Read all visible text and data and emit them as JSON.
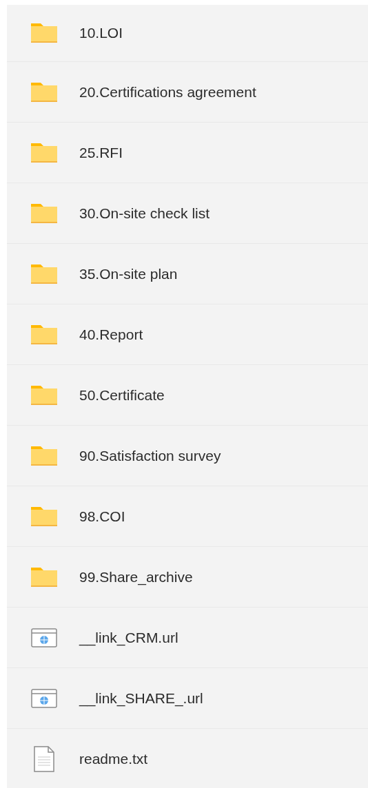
{
  "items": [
    {
      "kind": "folder",
      "name": "10.LOI"
    },
    {
      "kind": "folder",
      "name": "20.Certifications agreement"
    },
    {
      "kind": "folder",
      "name": "25.RFI"
    },
    {
      "kind": "folder",
      "name": "30.On-site check list"
    },
    {
      "kind": "folder",
      "name": "35.On-site plan"
    },
    {
      "kind": "folder",
      "name": "40.Report"
    },
    {
      "kind": "folder",
      "name": "50.Certificate"
    },
    {
      "kind": "folder",
      "name": "90.Satisfaction survey"
    },
    {
      "kind": "folder",
      "name": "98.COI"
    },
    {
      "kind": "folder",
      "name": "99.Share_archive"
    },
    {
      "kind": "link",
      "name": "__link_CRM.url"
    },
    {
      "kind": "link",
      "name": "__link_SHARE_.url"
    },
    {
      "kind": "text",
      "name": "readme.txt"
    }
  ]
}
